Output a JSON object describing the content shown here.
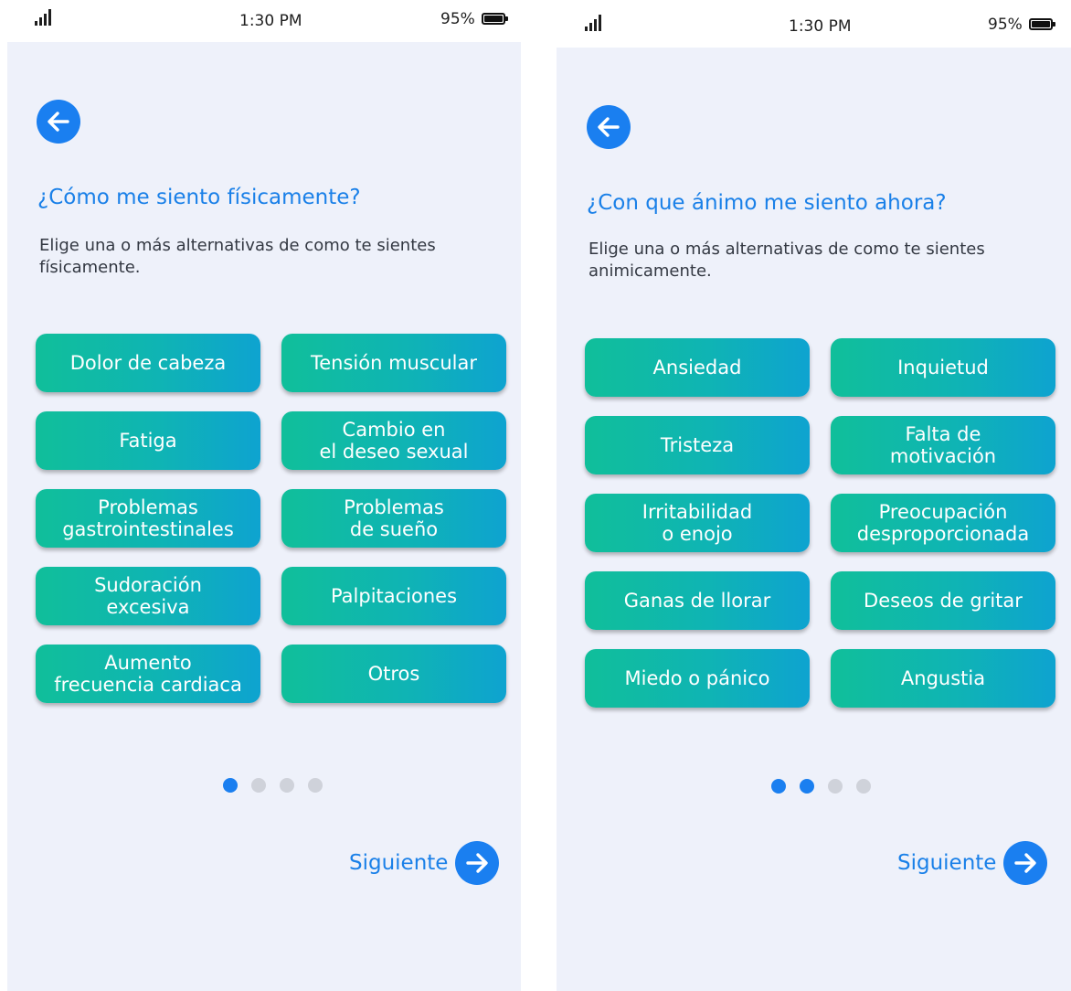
{
  "screens": [
    {
      "status": {
        "time": "1:30 PM",
        "battery": "95%"
      },
      "title": "¿Cómo me siento físicamente?",
      "subtitle": "Elige una o más  alternativas de como te sientes físicamente.",
      "options": [
        "Dolor de cabeza",
        "Tensión muscular",
        "Fatiga",
        "Cambio en\nel deseo sexual",
        "Problemas\ngastrointestinales",
        "Problemas\nde sueño",
        "Sudoración\nexcesiva",
        "Palpitaciones",
        "Aumento\nfrecuencia cardiaca",
        "Otros"
      ],
      "pagination": {
        "total": 4,
        "active": 1
      },
      "next_label": "Siguiente"
    },
    {
      "status": {
        "time": "1:30 PM",
        "battery": "95%"
      },
      "title": "¿Con que ánimo me siento ahora?",
      "subtitle": "Elige una o más  alternativas de como te sientes animicamente.",
      "options": [
        "Ansiedad",
        "Inquietud",
        "Tristeza",
        "Falta de\nmotivación",
        "Irritabilidad\no enojo",
        "Preocupación\ndesproporcionada",
        "Ganas de llorar",
        "Deseos de gritar",
        "Miedo o pánico",
        "Angustia"
      ],
      "pagination": {
        "total": 4,
        "active": 2
      },
      "next_label": "Siguiente"
    }
  ],
  "colors": {
    "accent": "#1a7ff0",
    "dot_active": "#1a7ff0",
    "dot_inactive": "#cfd2da",
    "background": "#eef1fa"
  },
  "icons": {
    "back": "arrow-left-icon",
    "next": "arrow-right-icon",
    "signal": "signal-icon",
    "battery": "battery-icon"
  }
}
